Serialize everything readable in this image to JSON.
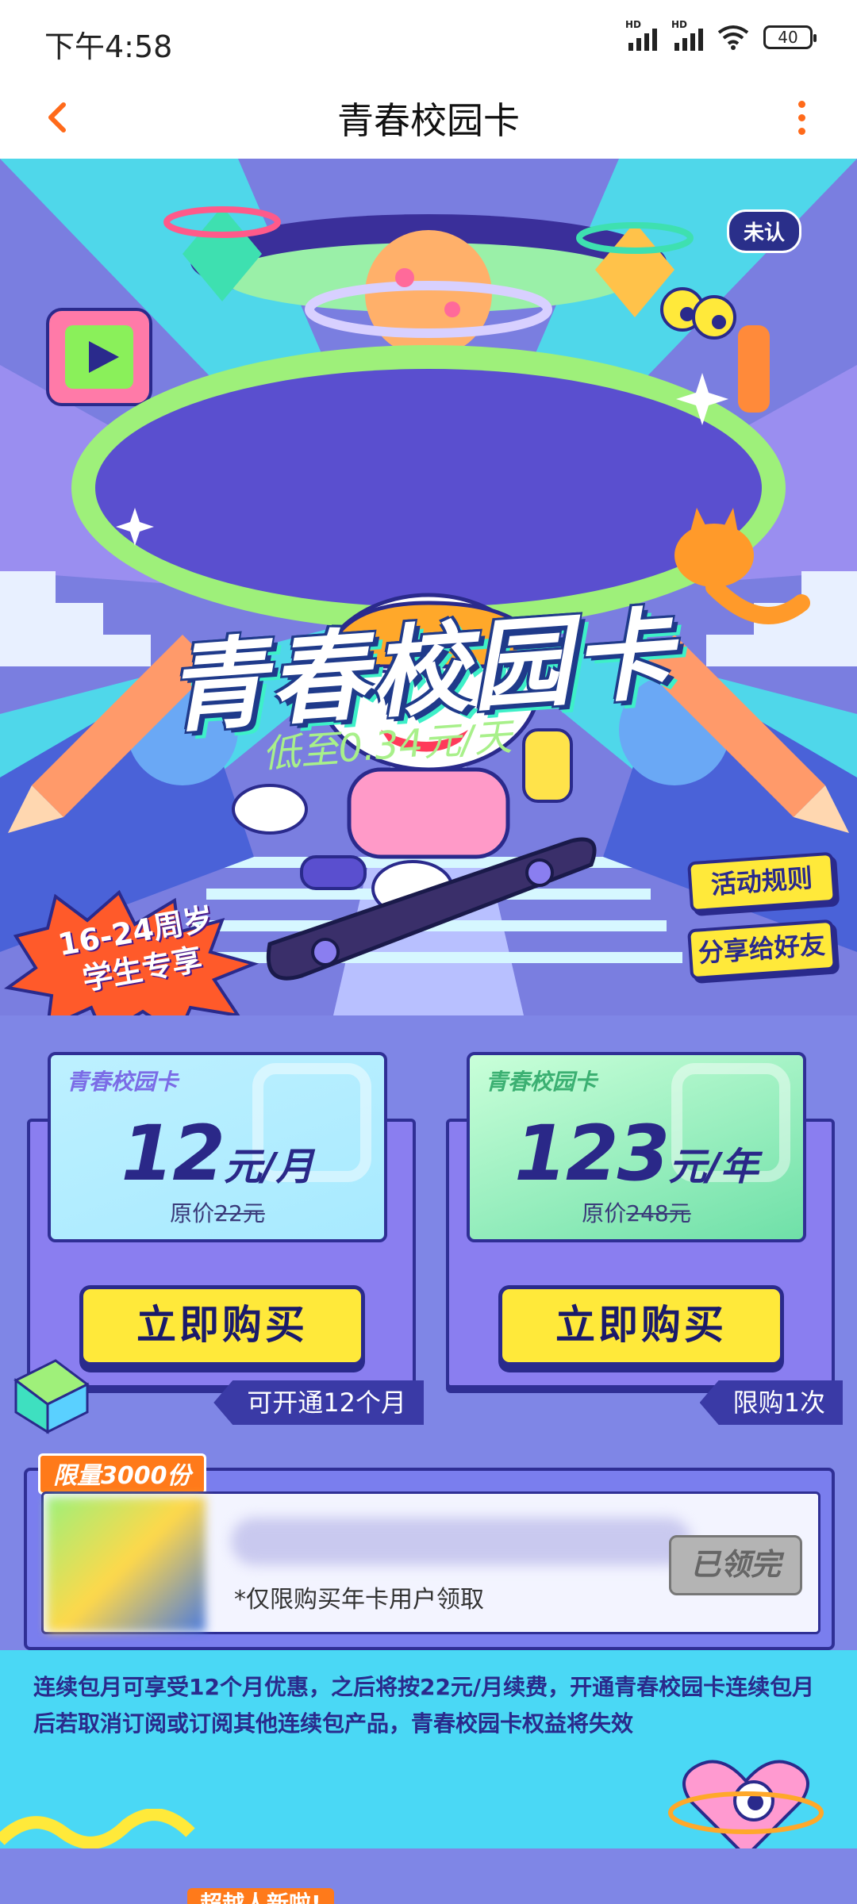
{
  "status_bar": {
    "time": "下午4:58",
    "network_1": "HD",
    "network_2": "HD",
    "battery": "40"
  },
  "header": {
    "title": "青春校园卡",
    "back_icon": "chevron-left-icon",
    "more_icon": "more-vertical-icon",
    "accent_color": "#ff6a1a"
  },
  "hero": {
    "title": "青春校园卡",
    "subtitle": "低至0.34元/天",
    "unverified_badge": "未认",
    "rules_button": "活动规则",
    "share_button": "分享给好友",
    "age_badge_line1": "16-24周岁",
    "age_badge_line2": "学生专享"
  },
  "plans": [
    {
      "tag": "青春校园卡",
      "price": "12",
      "unit": "元/月",
      "original_prefix": "原价",
      "original_price": "22元",
      "buy_label": "立即购买",
      "note": "可开通12个月"
    },
    {
      "tag": "青春校园卡",
      "price": "123",
      "unit": "元/年",
      "original_prefix": "原价",
      "original_price": "248元",
      "buy_label": "立即购买",
      "note": "限购1次"
    }
  ],
  "coupon": {
    "label": "限量3000份",
    "note": "*仅限购买年卡用户领取",
    "claimed_label": "已领完"
  },
  "info": {
    "text": "连续包月可享受12个月优惠，之后将按22元/月续费，开通青春校园卡连续包月后若取消订阅或订阅其他连续包产品，青春校园卡权益将失效"
  },
  "bottom": {
    "tag": "超越人新啦!"
  },
  "colors": {
    "primary_blue": "#2a2a8c",
    "button_yellow": "#ffe93a",
    "badge_orange": "#ff7a1a",
    "background_purple": "#7f86e6",
    "background_cyan": "#4ad8f5"
  }
}
